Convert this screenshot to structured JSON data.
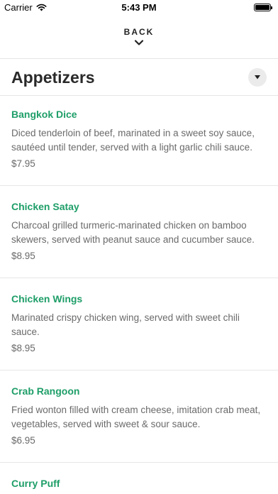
{
  "status_bar": {
    "carrier": "Carrier",
    "time": "5:43 PM",
    "wifi_icon": "wifi-icon",
    "battery_icon": "battery-icon"
  },
  "nav": {
    "back_label": "BACK",
    "back_icon": "chevron-down-icon"
  },
  "section": {
    "title": "Appetizers",
    "toggle_icon": "caret-down-icon"
  },
  "colors": {
    "item_name": "#1e9e68",
    "description": "#6a6a6a",
    "divider": "#e6e6e6"
  },
  "items": [
    {
      "name": "Bangkok Dice",
      "description": "Diced tenderloin of beef, marinated in a sweet soy sauce, sautéed until tender, served with a light garlic chili sauce.",
      "price": "$7.95"
    },
    {
      "name": "Chicken Satay",
      "description": "Charcoal grilled turmeric-marinated chicken on bamboo skewers, served with peanut sauce and cucumber sauce.",
      "price": "$8.95"
    },
    {
      "name": "Chicken Wings",
      "description": "Marinated crispy chicken wing, served with sweet chili sauce.",
      "price": "$8.95"
    },
    {
      "name": "Crab Rangoon",
      "description": "Fried wonton filled with cream cheese, imitation crab meat, vegetables, served with sweet & sour sauce.",
      "price": "$6.95"
    },
    {
      "name": "Curry Puff",
      "description": "",
      "price": ""
    }
  ]
}
